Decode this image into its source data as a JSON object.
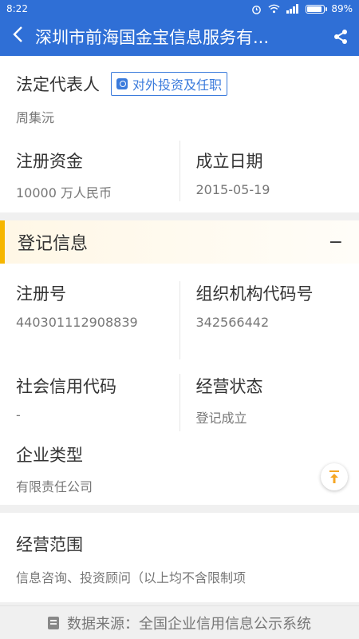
{
  "status_bar": {
    "time": "8:22",
    "battery": "89%",
    "battery_level": 0.89
  },
  "header": {
    "title": "深圳市前海国金宝信息服务有...",
    "back_icon": "back-arrow-icon",
    "share_icon": "share-icon"
  },
  "legal_rep": {
    "label": "法定代表人",
    "badge": "对外投资及任职",
    "name": "周集沅"
  },
  "capital": {
    "label": "注册资金",
    "value": "10000 万人民币"
  },
  "founded": {
    "label": "成立日期",
    "value": "2015-05-19"
  },
  "registration": {
    "title": "登记信息",
    "collapse": "−",
    "reg_no": {
      "label": "注册号",
      "value": "440301112908839"
    },
    "org_code": {
      "label": "组织机构代码号",
      "value": "342566442"
    },
    "credit_code": {
      "label": "社会信用代码",
      "value": "-"
    },
    "op_status": {
      "label": "经营状态",
      "value": "登记成立"
    },
    "company_type": {
      "label": "企业类型",
      "value": "有限责任公司"
    }
  },
  "business_scope": {
    "label": "经营范围",
    "value": "信息咨询、投资顾问（以上均不含限制项"
  },
  "footer": {
    "text": "数据来源：全国企业信用信息公示系统"
  }
}
